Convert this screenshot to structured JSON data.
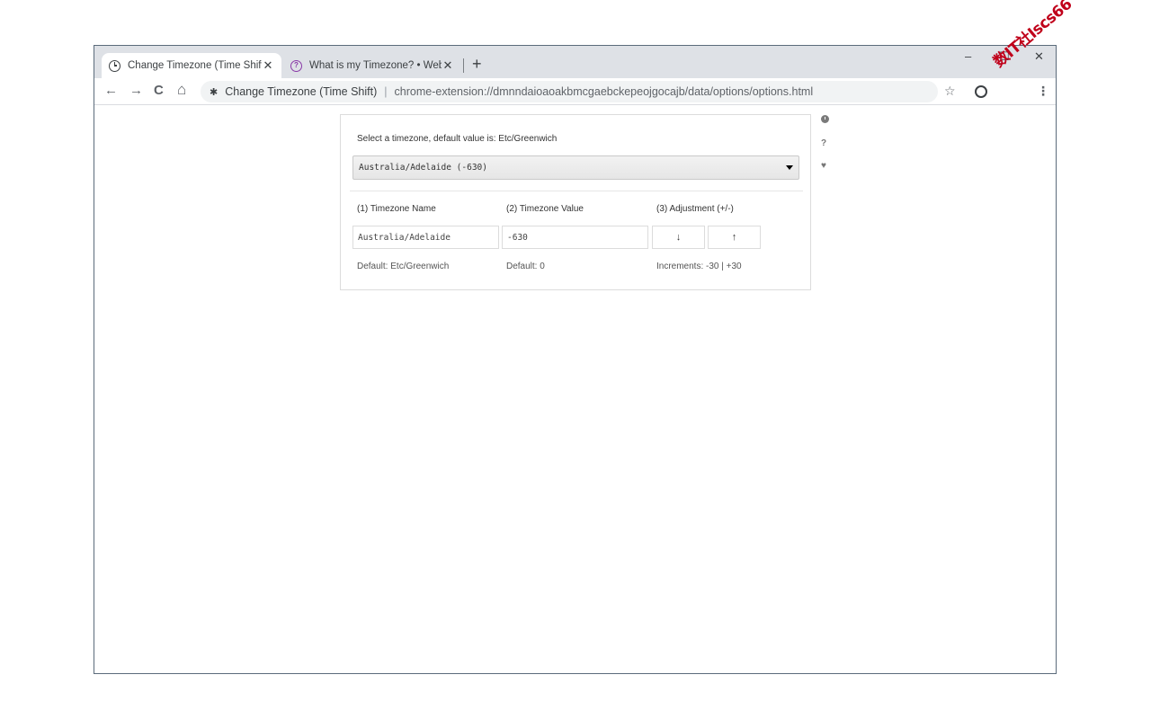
{
  "tabs": [
    {
      "title": "Change Timezone (Time Shift)",
      "icon": "clock-icon",
      "active": true
    },
    {
      "title": "What is my Timezone? • WebBro",
      "icon": "question-icon",
      "active": false
    }
  ],
  "window": {
    "minimize": "–",
    "maximize": "☐",
    "close": "✕"
  },
  "toolbar": {
    "back": "←",
    "forward": "→",
    "reload": "C",
    "home": "⌂",
    "omnibox_label": "Change Timezone (Time Shift)",
    "omnibox_url": "chrome-extension://dmnndaioaoakbmcgaebckepeojgocajb/data/options/options.html",
    "bookmark": "☆",
    "menu": "⋮"
  },
  "options": {
    "caption": "Select a timezone, default value is: Etc/Greenwich",
    "selected": "Australia/Adelaide (-630)",
    "columns": [
      "(1) Timezone Name",
      "(2) Timezone Value",
      "(3) Adjustment (+/-)"
    ],
    "timezone_name": "Australia/Adelaide",
    "timezone_value": "-630",
    "down_label": "↓",
    "up_label": "↑",
    "notes": [
      "Default: Etc/Greenwich",
      "Default: 0",
      "Increments: -30 | +30"
    ]
  },
  "side": {
    "help": "?",
    "heart": "♥"
  },
  "watermark": "数IT社Iscs66"
}
